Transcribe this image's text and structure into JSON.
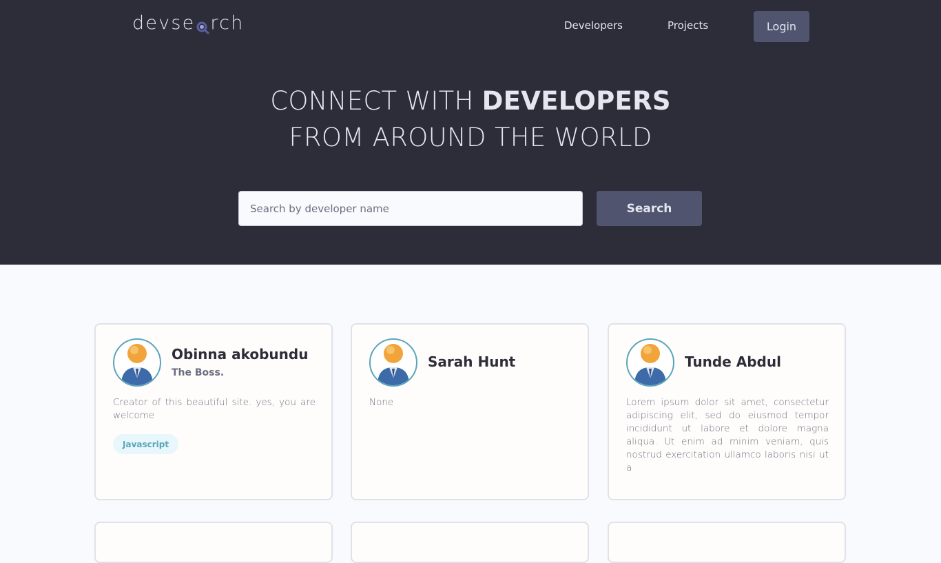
{
  "nav": {
    "logo_left": "devse",
    "logo_right": "rch",
    "developers": "Developers",
    "projects": "Projects",
    "login": "Login"
  },
  "hero": {
    "line1_light": "CONNECT WITH ",
    "line1_bold": "DEVELOPERS",
    "line2": "FROM AROUND THE WORLD",
    "search_placeholder": "Search by developer name",
    "search_value": "",
    "search_button": "Search"
  },
  "developers": [
    {
      "name": "Obinna akobundu",
      "headline": "The Boss.",
      "bio": "Creator of this beautiful site. yes, you are welcome",
      "skills": [
        "Javascript"
      ]
    },
    {
      "name": "Sarah Hunt",
      "headline": "",
      "bio": "None",
      "skills": []
    },
    {
      "name": "Tunde Abdul",
      "headline": "",
      "bio": "Lorem ipsum dolor sit amet, consectetur adipiscing elit, sed do eiusmod tempor incididunt ut labore et dolore magna aliqua. Ut enim ad minim veniam, quis nostrud exercitation ullamco laboris nisi ut a",
      "skills": []
    }
  ],
  "colors": {
    "header_bg": "#2d2d39",
    "button_bg": "#51546e",
    "page_bg": "#f8fafd",
    "accent": "#5aa5b9"
  },
  "icons": {
    "logo_mark": "magnifier-icon",
    "avatar": "default-user-avatar-icon"
  }
}
